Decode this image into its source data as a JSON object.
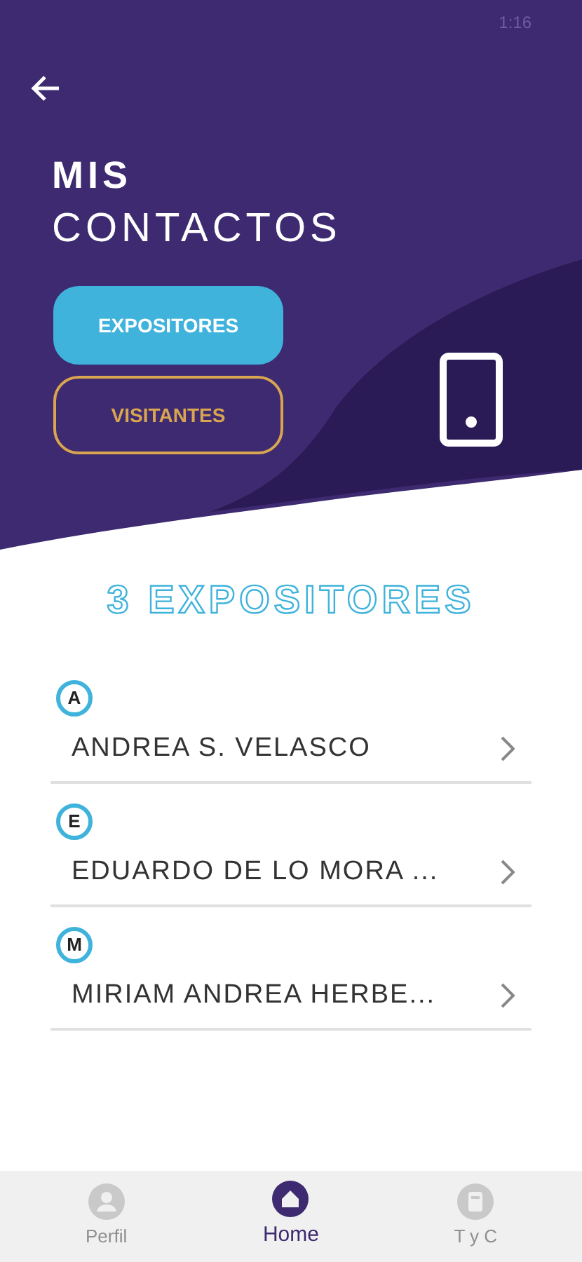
{
  "status_bar": {
    "time": "1:16"
  },
  "header": {
    "title_line_1": "MIS",
    "title_line_2": "CONTACTOS"
  },
  "tabs": [
    {
      "label": "EXPOSITORES",
      "selected": true
    },
    {
      "label": "VISITANTES",
      "selected": false
    }
  ],
  "list_heading": "3 EXPOSITORES",
  "groups": [
    {
      "letter": "A",
      "contacts": [
        {
          "name": "ANDREA S. VELASCO"
        }
      ]
    },
    {
      "letter": "E",
      "contacts": [
        {
          "name": "EDUARDO DE LO MORA ..."
        }
      ]
    },
    {
      "letter": "M",
      "contacts": [
        {
          "name": "MIRIAM ANDREA HERBE..."
        }
      ]
    }
  ],
  "bottom_nav": [
    {
      "label": "Perfil",
      "kind": "profile",
      "selected": false
    },
    {
      "label": "Home",
      "kind": "home",
      "selected": true
    },
    {
      "label": "T y C",
      "kind": "terms",
      "selected": false
    }
  ]
}
